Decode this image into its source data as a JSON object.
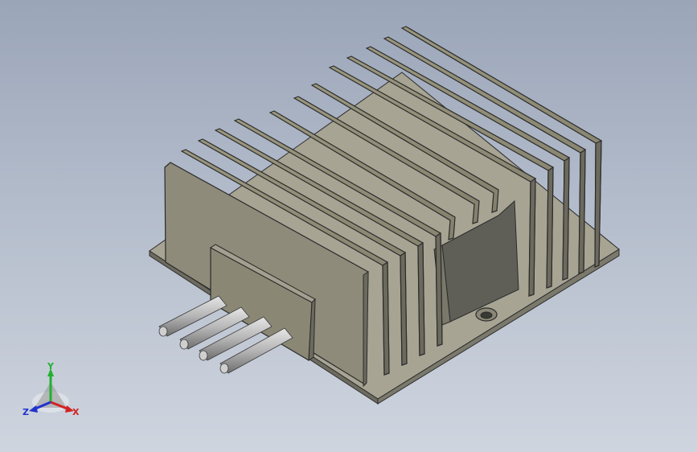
{
  "viewport": {
    "background_top": "#9aa5b8",
    "background_bottom": "#cfd5df"
  },
  "model": {
    "body_color": "#8b8878",
    "shadow_color": "#5f5e57",
    "pin_color": "#bcbcbc",
    "pin_count": 4
  },
  "triad": {
    "x_label": "X",
    "y_label": "Y",
    "z_label": "Z",
    "x_color": "#d22222",
    "y_color": "#22b030",
    "z_color": "#2233cc"
  }
}
